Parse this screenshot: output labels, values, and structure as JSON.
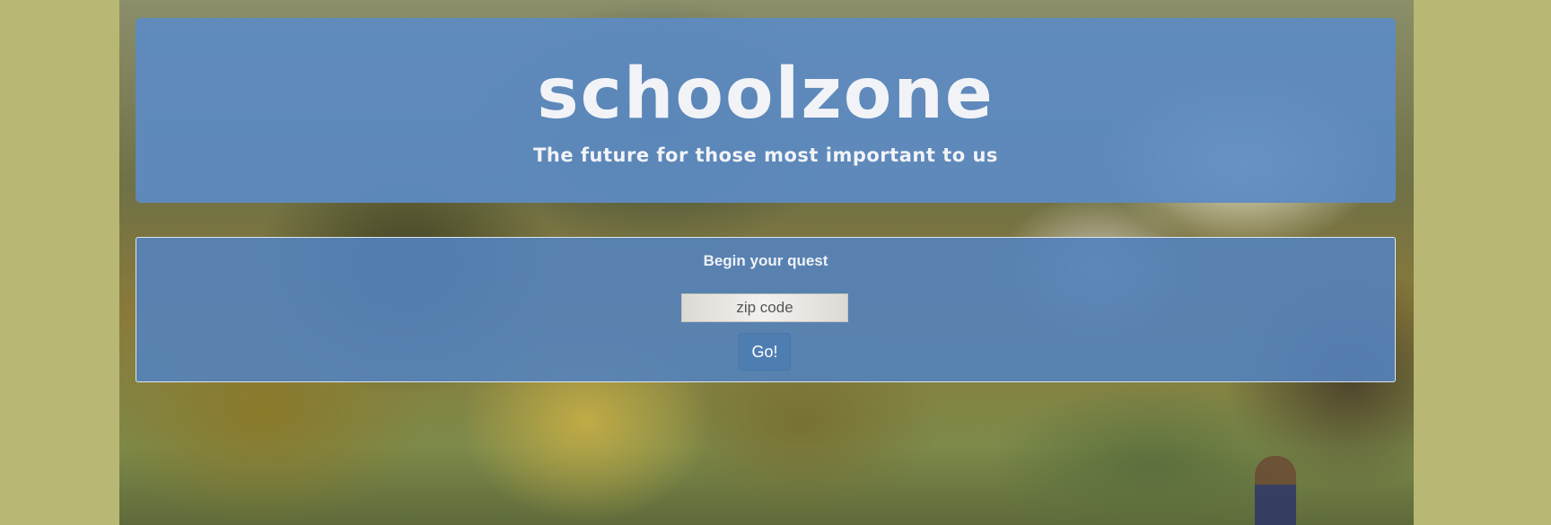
{
  "hero": {
    "title": "schoolzone",
    "subtitle": "The future for those most important to us"
  },
  "quest": {
    "heading": "Begin your quest",
    "zip_placeholder": "zip code",
    "zip_value": "",
    "go_label": "Go!"
  },
  "colors": {
    "page_background": "#b8b774",
    "panel_blue": "#5c8bc3",
    "button_blue": "#4e7db2",
    "text_white": "#f2f3f7"
  }
}
